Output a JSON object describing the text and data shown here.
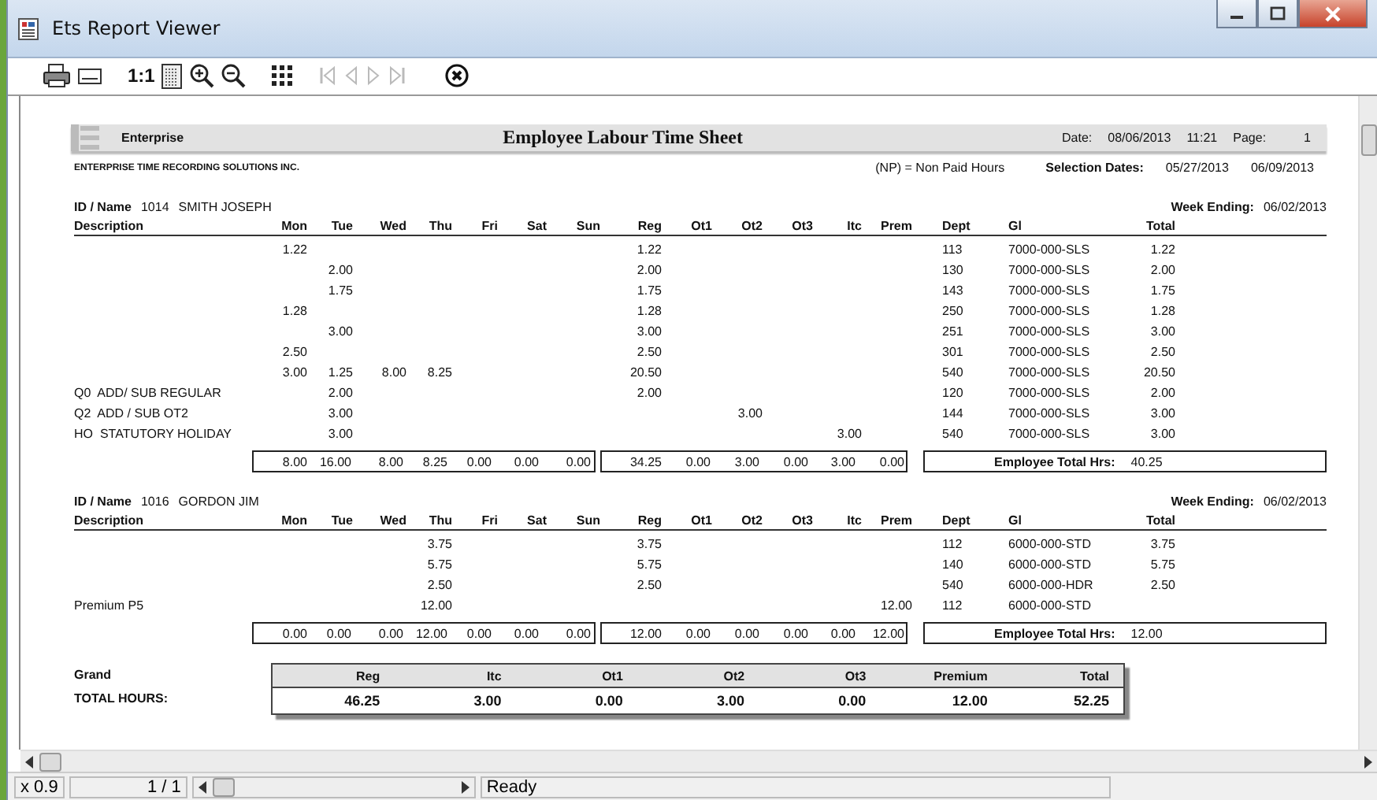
{
  "window": {
    "title": "Ets Report Viewer"
  },
  "toolbar": [
    {
      "kind": "print",
      "disabled": false
    },
    {
      "kind": "page-setup",
      "disabled": false
    },
    {
      "kind": "actual-size",
      "label": "1:1",
      "disabled": false
    },
    {
      "kind": "page",
      "disabled": false
    },
    {
      "kind": "zoom-in",
      "disabled": false
    },
    {
      "kind": "zoom-out",
      "disabled": false
    },
    {
      "kind": "grid",
      "disabled": false
    },
    {
      "kind": "first",
      "disabled": true
    },
    {
      "kind": "prev",
      "disabled": true
    },
    {
      "kind": "next",
      "disabled": true
    },
    {
      "kind": "last",
      "disabled": true
    },
    {
      "kind": "close",
      "disabled": false
    }
  ],
  "report": {
    "company_short": "Enterprise",
    "title": "Employee Labour Time Sheet",
    "date_label": "Date:",
    "date": "08/06/2013",
    "time": "11:21",
    "page_label": "Page:",
    "page": "1",
    "company": "ENTERPRISE TIME RECORDING SOLUTIONS INC.",
    "note": "(NP) = Non Paid Hours",
    "selection_label": "Selection Dates:",
    "selection_from": "05/27/2013",
    "selection_to": "06/09/2013",
    "employees": [
      {
        "id_label": "ID / Name",
        "id": "1014",
        "name": "SMITH JOSEPH",
        "week_label": "Week Ending:",
        "week_ending": "06/02/2013",
        "columns": [
          "Description",
          "Mon",
          "Tue",
          "Wed",
          "Thu",
          "Fri",
          "Sat",
          "Sun",
          "Reg",
          "Ot1",
          "Ot2",
          "Ot3",
          "Itc",
          "Prem",
          "Dept",
          "Gl",
          "Total"
        ],
        "rows": [
          [
            null,
            "1.22",
            null,
            null,
            null,
            null,
            null,
            null,
            "1.22",
            null,
            null,
            null,
            null,
            null,
            "113",
            "7000-000-SLS",
            "1.22"
          ],
          [
            null,
            null,
            "2.00",
            null,
            null,
            null,
            null,
            null,
            "2.00",
            null,
            null,
            null,
            null,
            null,
            "130",
            "7000-000-SLS",
            "2.00"
          ],
          [
            null,
            null,
            "1.75",
            null,
            null,
            null,
            null,
            null,
            "1.75",
            null,
            null,
            null,
            null,
            null,
            "143",
            "7000-000-SLS",
            "1.75"
          ],
          [
            null,
            "1.28",
            null,
            null,
            null,
            null,
            null,
            null,
            "1.28",
            null,
            null,
            null,
            null,
            null,
            "250",
            "7000-000-SLS",
            "1.28"
          ],
          [
            null,
            null,
            "3.00",
            null,
            null,
            null,
            null,
            null,
            "3.00",
            null,
            null,
            null,
            null,
            null,
            "251",
            "7000-000-SLS",
            "3.00"
          ],
          [
            null,
            "2.50",
            null,
            null,
            null,
            null,
            null,
            null,
            "2.50",
            null,
            null,
            null,
            null,
            null,
            "301",
            "7000-000-SLS",
            "2.50"
          ],
          [
            null,
            "3.00",
            "1.25",
            "8.00",
            "8.25",
            null,
            null,
            null,
            "20.50",
            null,
            null,
            null,
            null,
            null,
            "540",
            "7000-000-SLS",
            "20.50"
          ],
          [
            "Q0  ADD/ SUB REGULAR",
            null,
            "2.00",
            null,
            null,
            null,
            null,
            null,
            "2.00",
            null,
            null,
            null,
            null,
            null,
            "120",
            "7000-000-SLS",
            "2.00"
          ],
          [
            "Q2  ADD / SUB OT2",
            null,
            "3.00",
            null,
            null,
            null,
            null,
            null,
            null,
            null,
            "3.00",
            null,
            null,
            null,
            "144",
            "7000-000-SLS",
            "3.00"
          ],
          [
            "HO  STATUTORY HOLIDAY",
            null,
            "3.00",
            null,
            null,
            null,
            null,
            null,
            null,
            null,
            null,
            null,
            "3.00",
            null,
            "540",
            "7000-000-SLS",
            "3.00"
          ]
        ],
        "day_totals": [
          "8.00",
          "16.00",
          "8.00",
          "8.25",
          "0.00",
          "0.00",
          "0.00"
        ],
        "pay_totals": [
          "34.25",
          "0.00",
          "3.00",
          "0.00",
          "3.00",
          "0.00"
        ],
        "total_label": "Employee Total Hrs:",
        "total_hours": "40.25"
      },
      {
        "id_label": "ID / Name",
        "id": "1016",
        "name": "GORDON JIM",
        "week_label": "Week Ending:",
        "week_ending": "06/02/2013",
        "columns": [
          "Description",
          "Mon",
          "Tue",
          "Wed",
          "Thu",
          "Fri",
          "Sat",
          "Sun",
          "Reg",
          "Ot1",
          "Ot2",
          "Ot3",
          "Itc",
          "Prem",
          "Dept",
          "Gl",
          "Total"
        ],
        "rows": [
          [
            null,
            null,
            null,
            null,
            "3.75",
            null,
            null,
            null,
            "3.75",
            null,
            null,
            null,
            null,
            null,
            "112",
            "6000-000-STD",
            "3.75"
          ],
          [
            null,
            null,
            null,
            null,
            "5.75",
            null,
            null,
            null,
            "5.75",
            null,
            null,
            null,
            null,
            null,
            "140",
            "6000-000-STD",
            "5.75"
          ],
          [
            null,
            null,
            null,
            null,
            "2.50",
            null,
            null,
            null,
            "2.50",
            null,
            null,
            null,
            null,
            null,
            "540",
            "6000-000-HDR",
            "2.50"
          ],
          [
            "Premium P5",
            null,
            null,
            null,
            "12.00",
            null,
            null,
            null,
            null,
            null,
            null,
            null,
            null,
            "12.00",
            "112",
            "6000-000-STD",
            null
          ]
        ],
        "day_totals": [
          "0.00",
          "0.00",
          "0.00",
          "12.00",
          "0.00",
          "0.00",
          "0.00"
        ],
        "pay_totals": [
          "12.00",
          "0.00",
          "0.00",
          "0.00",
          "0.00",
          "12.00"
        ],
        "total_label": "Employee Total Hrs:",
        "total_hours": "12.00"
      }
    ],
    "grand": {
      "title": "Grand",
      "label": "TOTAL HOURS:",
      "columns": [
        "Reg",
        "Itc",
        "Ot1",
        "Ot2",
        "Ot3",
        "Premium",
        "Total"
      ],
      "values": [
        "46.25",
        "3.00",
        "0.00",
        "3.00",
        "0.00",
        "12.00",
        "52.25"
      ]
    }
  },
  "status_bar": {
    "zoom": "x 0.9",
    "pages": "1 / 1",
    "status": "Ready"
  }
}
